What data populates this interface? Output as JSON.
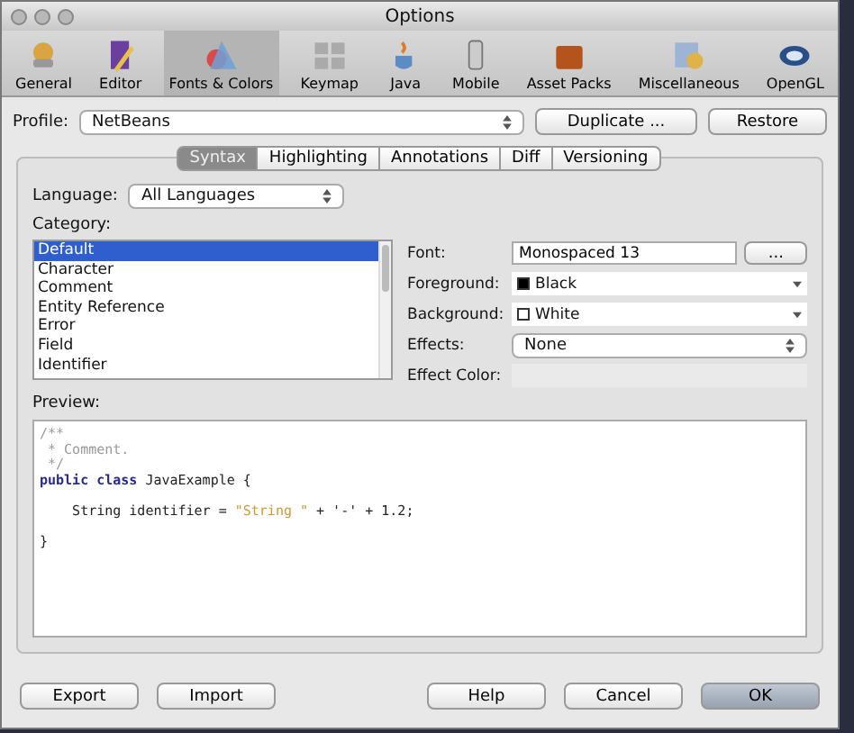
{
  "window": {
    "title": "Options"
  },
  "toolbar": [
    {
      "label": "General",
      "selected": false
    },
    {
      "label": "Editor",
      "selected": false
    },
    {
      "label": "Fonts & Colors",
      "selected": true
    },
    {
      "label": "Keymap",
      "selected": false
    },
    {
      "label": "Java",
      "selected": false
    },
    {
      "label": "Mobile",
      "selected": false
    },
    {
      "label": "Asset Packs",
      "selected": false
    },
    {
      "label": "Miscellaneous",
      "selected": false
    },
    {
      "label": "OpenGL",
      "selected": false
    }
  ],
  "profile": {
    "label": "Profile:",
    "value": "NetBeans",
    "buttons": [
      "Duplicate ...",
      "Restore"
    ]
  },
  "tabs": [
    {
      "label": "Syntax",
      "selected": true
    },
    {
      "label": "Highlighting",
      "selected": false
    },
    {
      "label": "Annotations",
      "selected": false
    },
    {
      "label": "Diff",
      "selected": false
    },
    {
      "label": "Versioning",
      "selected": false
    }
  ],
  "language": {
    "label": "Language:",
    "value": "All Languages"
  },
  "category": {
    "label": "Category:",
    "items": [
      {
        "label": "Default",
        "selected": true
      },
      {
        "label": "Character",
        "selected": false
      },
      {
        "label": "Comment",
        "selected": false
      },
      {
        "label": "Entity Reference",
        "selected": false
      },
      {
        "label": "Error",
        "selected": false
      },
      {
        "label": "Field",
        "selected": false
      },
      {
        "label": "Identifier",
        "selected": false
      }
    ]
  },
  "properties": [
    {
      "kind": "text",
      "label": "Font:",
      "value": "Monospaced 13",
      "button": "..."
    },
    {
      "kind": "color",
      "label": "Foreground:",
      "value": "Black",
      "color": "#000000"
    },
    {
      "kind": "color",
      "label": "Background:",
      "value": "White",
      "color": "#ffffff"
    },
    {
      "kind": "select",
      "label": "Effects:",
      "value": "None"
    },
    {
      "kind": "disabled",
      "label": "Effect Color:"
    }
  ],
  "preview": {
    "label": "Preview:",
    "lines": [
      {
        "kind": "code",
        "tokens": [
          {
            "kind": "comment",
            "text": "/**"
          }
        ]
      },
      {
        "kind": "code",
        "tokens": [
          {
            "kind": "comment",
            "text": " * Comment."
          }
        ]
      },
      {
        "kind": "code",
        "tokens": [
          {
            "kind": "comment",
            "text": " */"
          }
        ]
      },
      {
        "kind": "code",
        "tokens": [
          {
            "kind": "keyword",
            "text": "public class "
          },
          {
            "kind": "plain",
            "text": "JavaExample {"
          }
        ]
      },
      {
        "kind": "blank"
      },
      {
        "kind": "code",
        "tokens": [
          {
            "kind": "plain",
            "text": "    String identifier = "
          },
          {
            "kind": "string",
            "text": "\"String \""
          },
          {
            "kind": "plain",
            "text": " + '-' + 1.2;"
          }
        ]
      },
      {
        "kind": "blank"
      },
      {
        "kind": "code",
        "tokens": [
          {
            "kind": "plain",
            "text": "}"
          }
        ]
      }
    ]
  },
  "buttons": [
    {
      "label": "Export",
      "default": false
    },
    {
      "label": "Import",
      "default": false
    },
    {
      "label": "Help",
      "default": false
    },
    {
      "label": "Cancel",
      "default": false
    },
    {
      "label": "OK",
      "default": true
    }
  ]
}
